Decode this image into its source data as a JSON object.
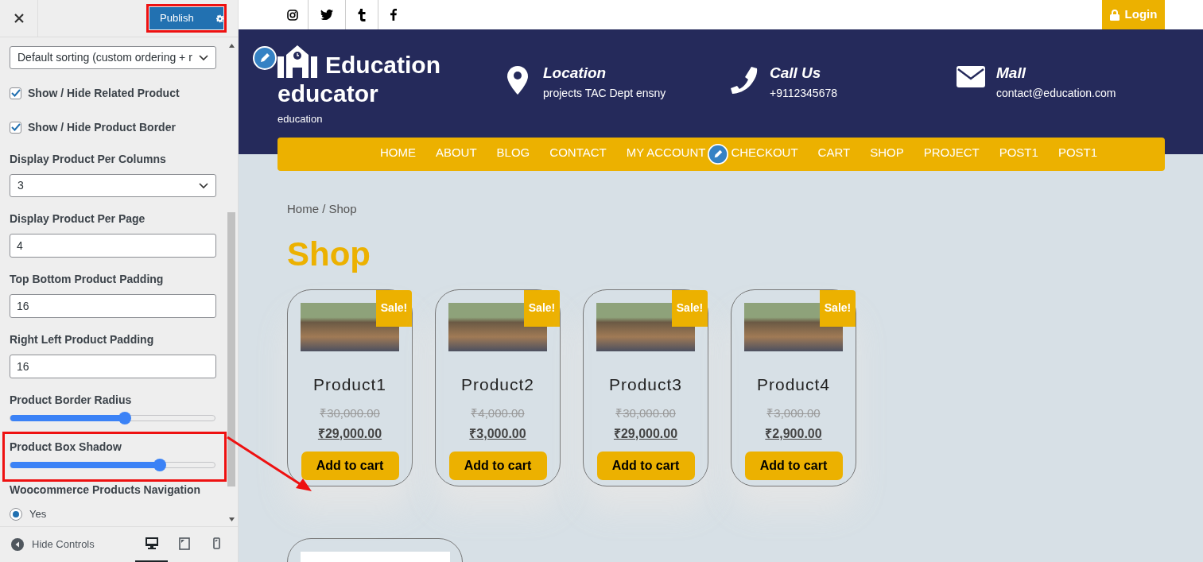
{
  "customizer": {
    "publish_label": "Publish",
    "publish_highlighted": true,
    "controls": [
      {
        "kind": "select",
        "value": "Default sorting (custom ordering + r"
      },
      {
        "kind": "checkbox",
        "label": "Show / Hide Related Product",
        "checked": true
      },
      {
        "kind": "checkbox",
        "label": "Show / Hide Product Border",
        "checked": true
      },
      {
        "kind": "select",
        "label": "Display Product Per Columns",
        "value": "3"
      },
      {
        "kind": "input",
        "label": "Display Product Per Page",
        "value": "4"
      },
      {
        "kind": "input",
        "label": "Top Bottom Product Padding",
        "value": "16"
      },
      {
        "kind": "input",
        "label": "Right Left Product Padding",
        "value": "16"
      },
      {
        "kind": "slider",
        "label": "Product Border Radius",
        "level": 0.56,
        "highlighted": false
      },
      {
        "kind": "slider",
        "label": "Product Box Shadow",
        "level": 0.73,
        "highlighted": true
      },
      {
        "kind": "radio",
        "label": "Woocommerce Products Navigation",
        "options": [
          {
            "label": "Yes",
            "selected": true
          }
        ]
      }
    ],
    "hide_controls": "Hide Controls",
    "devices": [
      {
        "kind": "desktop",
        "selected": true
      },
      {
        "kind": "tablet",
        "selected": false
      },
      {
        "kind": "mobile",
        "selected": false
      }
    ]
  },
  "site": {
    "login": "Login",
    "logo_title": "Education educator",
    "tagline": "education",
    "contacts": [
      {
        "kind": "location",
        "title": "Location",
        "value": "projects TAC Dept ensny"
      },
      {
        "kind": "phone",
        "title": "Call Us",
        "value": "+9112345678"
      },
      {
        "kind": "mail",
        "title": "Mall",
        "value": "contact@education.com"
      }
    ],
    "nav": [
      "HOME",
      "ABOUT",
      "BLOG",
      "CONTACT",
      "MY ACCOUNT",
      "CHECKOUT",
      "CART",
      "SHOP",
      "PROJECT",
      "POST1",
      "POST1"
    ],
    "breadcrumb": "Home / Shop",
    "heading": "Shop",
    "products": [
      {
        "badge": "Sale!",
        "name": "Product1",
        "old_price": "₹30,000.00",
        "price": "₹29,000.00",
        "button": "Add to cart"
      },
      {
        "badge": "Sale!",
        "name": "Product2",
        "old_price": "₹4,000.00",
        "price": "₹3,000.00",
        "button": "Add to cart"
      },
      {
        "badge": "Sale!",
        "name": "Product3",
        "old_price": "₹30,000.00",
        "price": "₹29,000.00",
        "button": "Add to cart"
      },
      {
        "badge": "Sale!",
        "name": "Product4",
        "old_price": "₹3,000.00",
        "price": "₹2,900.00",
        "button": "Add to cart"
      }
    ]
  }
}
